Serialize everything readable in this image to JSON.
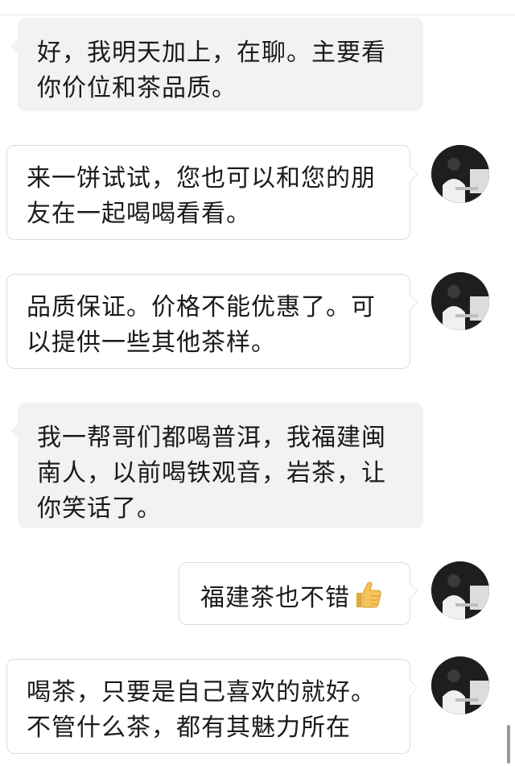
{
  "messages": [
    {
      "side": "incoming",
      "text": "好，我明天加上，在聊。主要看你价位和茶品质。"
    },
    {
      "side": "outgoing",
      "text": "来一饼试试，您也可以和您的朋友在一起喝喝看看。"
    },
    {
      "side": "outgoing",
      "text": "品质保证。价格不能优惠了。可以提供一些其他茶样。"
    },
    {
      "side": "incoming",
      "text": "我一帮哥们都喝普洱，我福建闽南人，以前喝铁观音，岩茶，让你笑话了。"
    },
    {
      "side": "outgoing",
      "text": "福建茶也不错",
      "emoji": "thumbs-up-icon"
    },
    {
      "side": "outgoing",
      "text": "喝茶，只要是自己喜欢的就好。不管什么茶，都有其魅力所在"
    }
  ],
  "colors": {
    "incoming_bubble": "#f2f2f2",
    "outgoing_bubble": "#ffffff",
    "outgoing_border": "#dcdcdc",
    "text": "#1a1a1a",
    "thumb": "#f4c45a"
  }
}
